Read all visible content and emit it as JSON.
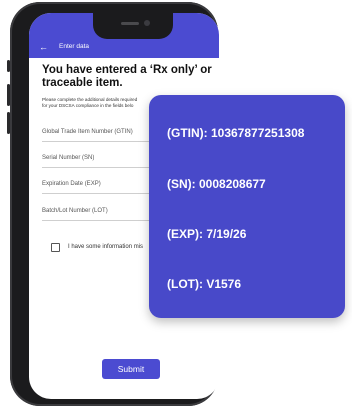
{
  "appbar": {
    "back_icon": "arrow-left-icon",
    "title": "Enter data"
  },
  "headline": "You have entered a ‘Rx only’ or traceable item.",
  "description": "Please complete the additional details required\nfor your DSCSA compliance in the fields belo",
  "fields": [
    {
      "label": "Global Trade Item Number (GTIN)"
    },
    {
      "label": "Serial Number (SN)"
    },
    {
      "label": "Expiration Date (EXP)"
    },
    {
      "label": "Batch/Lot Number (LOT)"
    }
  ],
  "checkbox": {
    "label": "I have some information mis"
  },
  "submit_label": "Submit",
  "card": {
    "gtin": "(GTIN): 10367877251308",
    "sn": "(SN): 0008208677",
    "exp": "(EXP): 7/19/26",
    "lot": "(LOT): V1576"
  },
  "colors": {
    "primary": "#4b4bd1",
    "card": "#4849c9",
    "phone_frame": "#1b1b1d"
  }
}
